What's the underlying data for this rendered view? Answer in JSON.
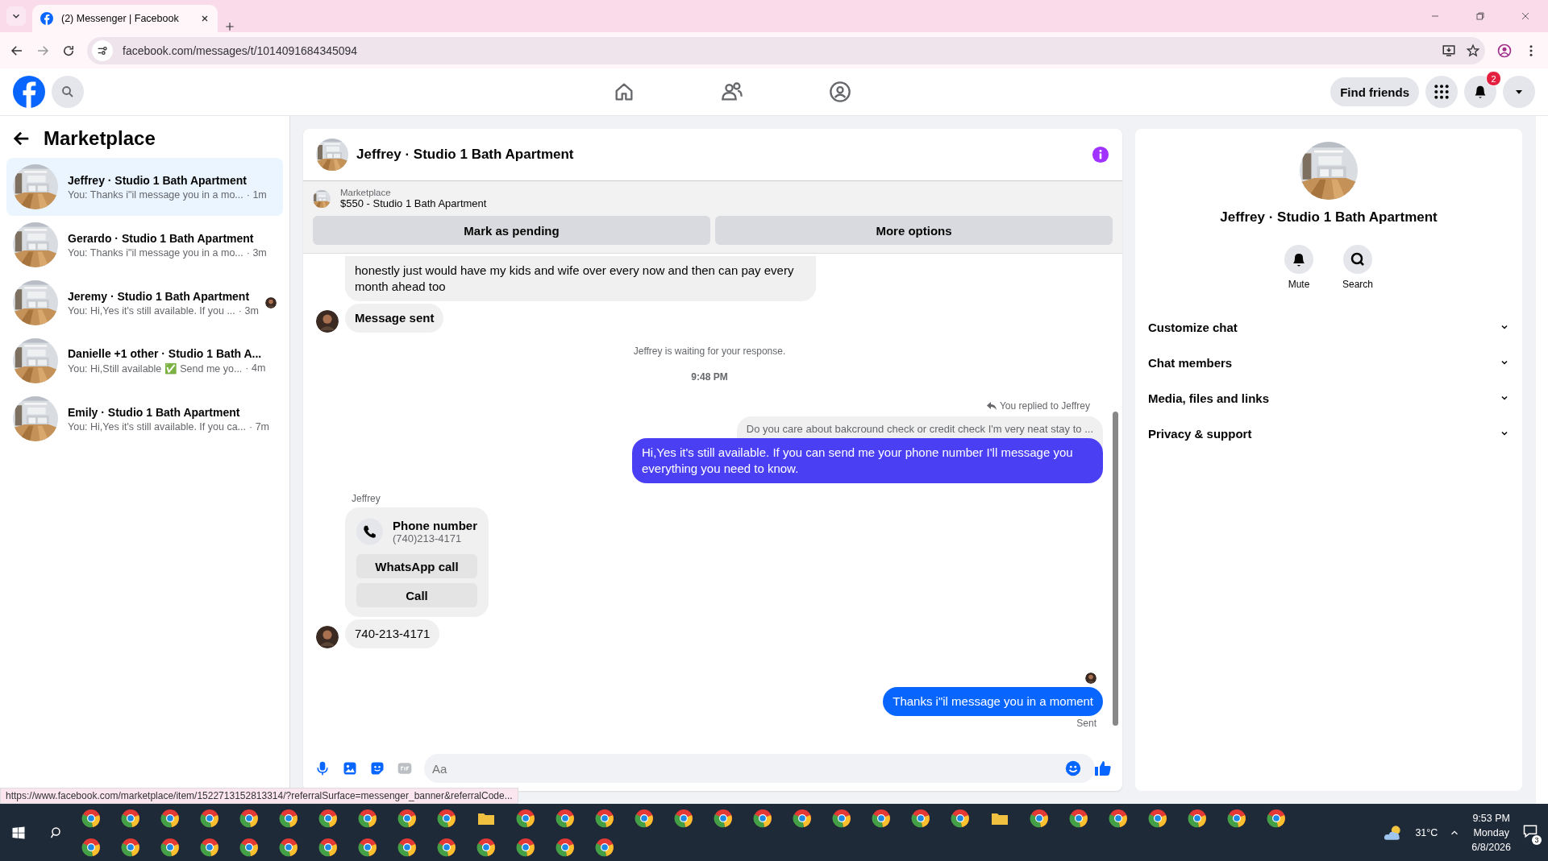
{
  "browser": {
    "tab_title": "(2) Messenger | Facebook",
    "url": "facebook.com/messages/t/1014091684345094"
  },
  "header": {
    "find_friends": "Find friends",
    "notification_count": "2"
  },
  "sidebar": {
    "title": "Marketplace",
    "conversations": [
      {
        "title": "Jeffrey · Studio 1 Bath Apartment",
        "preview": "You: Thanks i\"il message you in a mo...",
        "time": "· 1m",
        "selected": true,
        "read_receipt": false
      },
      {
        "title": "Gerardo · Studio 1 Bath Apartment",
        "preview": "You: Thanks i\"il message you in a mo...",
        "time": "· 3m",
        "selected": false,
        "read_receipt": false
      },
      {
        "title": "Jeremy · Studio 1 Bath Apartment",
        "preview": "You: Hi,Yes it's still available. If you ...",
        "time": "· 3m",
        "selected": false,
        "read_receipt": true
      },
      {
        "title": "Danielle +1 other · Studio 1 Bath A...",
        "preview": "You: Hi,Still available ✅ Send me yo...",
        "time": "· 4m",
        "selected": false,
        "read_receipt": false
      },
      {
        "title": "Emily · Studio 1 Bath Apartment",
        "preview": "You: Hi,Yes it's still available. If you ca...",
        "time": "· 7m",
        "selected": false,
        "read_receipt": false
      }
    ]
  },
  "chat": {
    "title": "Jeffrey · Studio 1 Bath Apartment",
    "listing": {
      "source": "Marketplace",
      "item": "$550 - Studio 1 Bath Apartment"
    },
    "actions": [
      "Mark as pending",
      "More options"
    ],
    "messages": [
      {
        "kind": "incoming",
        "text": "honestly just would have my kids and wife over every now and then can pay every month ahead too",
        "bold": false,
        "avatar": false
      },
      {
        "kind": "incoming",
        "text": "Message sent",
        "bold": true,
        "avatar": true
      },
      {
        "kind": "notice",
        "text": "Jeffrey is waiting for your response."
      },
      {
        "kind": "time",
        "text": "9:48 PM"
      },
      {
        "kind": "reply_label",
        "text": "You replied to Jeffrey"
      },
      {
        "kind": "quoted",
        "text": "Do you care about bakcround check or credit check I'm very neat stay to ..."
      },
      {
        "kind": "outgoing",
        "text": "Hi,Yes it's still available. If you can send me your phone number I'll message you everything you need to know.",
        "color": "#4a3ff2"
      },
      {
        "kind": "sender",
        "text": "Jeffrey"
      },
      {
        "kind": "contact_card",
        "title": "Phone number",
        "number": "(740)213-4171",
        "buttons": [
          "WhatsApp call",
          "Call"
        ]
      },
      {
        "kind": "incoming",
        "text": "740-213-4171",
        "bold": false,
        "avatar": true
      },
      {
        "kind": "read_receipt"
      },
      {
        "kind": "outgoing",
        "text": "Thanks i\"il message you in a moment",
        "color": "#0866ff"
      },
      {
        "kind": "status",
        "text": "Sent"
      }
    ],
    "composer": {
      "placeholder": "Aa"
    }
  },
  "details": {
    "title": "Jeffrey · Studio 1 Bath Apartment",
    "actions": [
      {
        "kind": "mute",
        "label": "Mute"
      },
      {
        "kind": "search",
        "label": "Search"
      }
    ],
    "sections": [
      {
        "label": "Customize chat",
        "expanded": false
      },
      {
        "label": "Chat members",
        "expanded": false
      },
      {
        "label": "Media, files and links",
        "expanded": false
      },
      {
        "label": "Privacy & support",
        "expanded": false
      }
    ]
  },
  "status_url": "https://www.facebook.com/marketplace/item/1522713152813314/?referralSurface=messenger_banner&referralCode...",
  "taskbar": {
    "weather": "31°C",
    "time": "9:53 PM",
    "day": "Monday",
    "date": "6/8/2026",
    "notifications": "3"
  }
}
